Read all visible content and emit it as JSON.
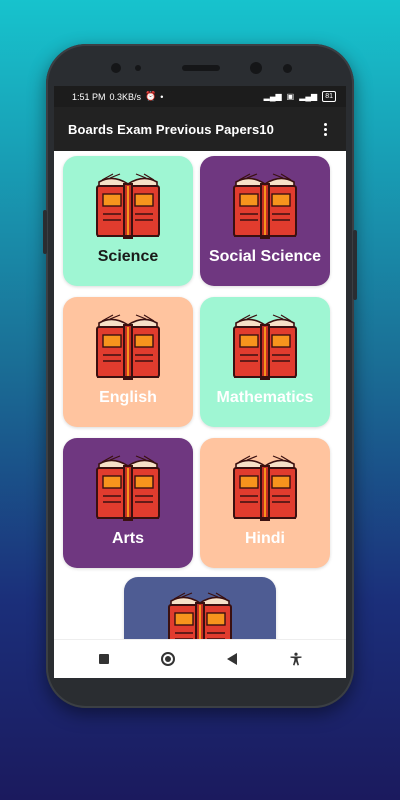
{
  "status_bar": {
    "time": "1:51 PM",
    "speed": "0.3KB/s",
    "battery": "81"
  },
  "app_bar": {
    "title": "Boards Exam Previous Papers10",
    "menu_icon": "more-vert-icon"
  },
  "subjects": [
    {
      "label": "Science",
      "bg": "#9ff6d3",
      "fg": "#1a1a1a"
    },
    {
      "label": "Social Science",
      "bg": "#6f3780",
      "fg": "#ffffff"
    },
    {
      "label": "English",
      "bg": "#ffc49f",
      "fg": "#ffffff"
    },
    {
      "label": "Mathematics",
      "bg": "#9ff6d3",
      "fg": "#ffffff"
    },
    {
      "label": "Arts",
      "bg": "#6f3780",
      "fg": "#ffffff"
    },
    {
      "label": "Hindi",
      "bg": "#ffc49f",
      "fg": "#ffffff"
    }
  ],
  "partial_card": {
    "bg": "#4e5c93"
  },
  "nav_bar": {
    "icons": [
      "recents-icon",
      "home-icon",
      "back-icon",
      "accessibility-icon"
    ]
  },
  "colors": {
    "appbar": "#222222",
    "book_red": "#e13c2e",
    "book_orange": "#f7941d",
    "book_outline": "#3a1010"
  }
}
